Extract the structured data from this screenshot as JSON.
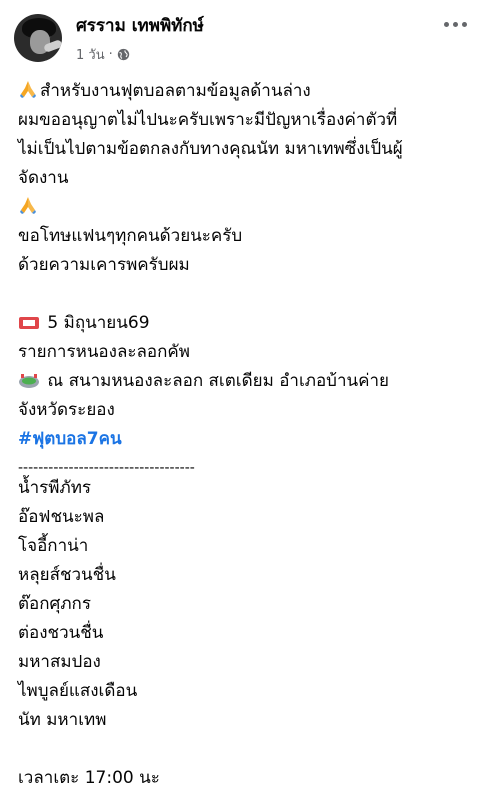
{
  "post": {
    "author": "ศรราม เทพพิทักษ์",
    "time": "1 วัน",
    "separator_dot": "·",
    "privacy_icon": "globe-icon",
    "more_icon": "more-dots-icon"
  },
  "lines": {
    "l1": "สำหรับงานฟุตบอลตามข้อมูลด้านล่าง",
    "l2": "ผมขออนุญาตไม่ไปนะครับเพราะมีปัญหาเรื่องค่าตัวที่",
    "l3": "ไม่เป็นไปตามข้อตกลงกับทางคุณนัท มหาเทพซึ่งเป็นผู้",
    "l4": "จัดงาน",
    "l5": "ขอโทษแฟนๆทุกคนด้วยนะครับ",
    "l6": "ด้วยความเคารพครับผม",
    "l7": "5 มิถุนายน69",
    "l8": "รายการหนองละลอกคัพ",
    "l9": "ณ สนามหนองละลอก สเตเดียม อำเภอบ้านค่าย",
    "l10": "จังหวัดระยอง",
    "hashtag": "#ฟุตบอล7คน",
    "separator": "-----------------------------------",
    "players": [
      " น้ำรพีภัทร",
      "อ๊อฟชนะพล",
      "โจอี้กาน่า",
      "หลุยส์ชวนชื่น",
      "ต๊อกศุภกร",
      "ต่องชวนชื่น",
      "มหาสมปอง",
      "ไพบูลย์แสงเดือน",
      "นัท มหาเทพ"
    ],
    "time_line": "เวลาเตะ 17:00 นะ"
  },
  "icons": {
    "pray": "folded-hands-icon",
    "ticket": "ticket-icon",
    "stadium": "stadium-icon"
  }
}
